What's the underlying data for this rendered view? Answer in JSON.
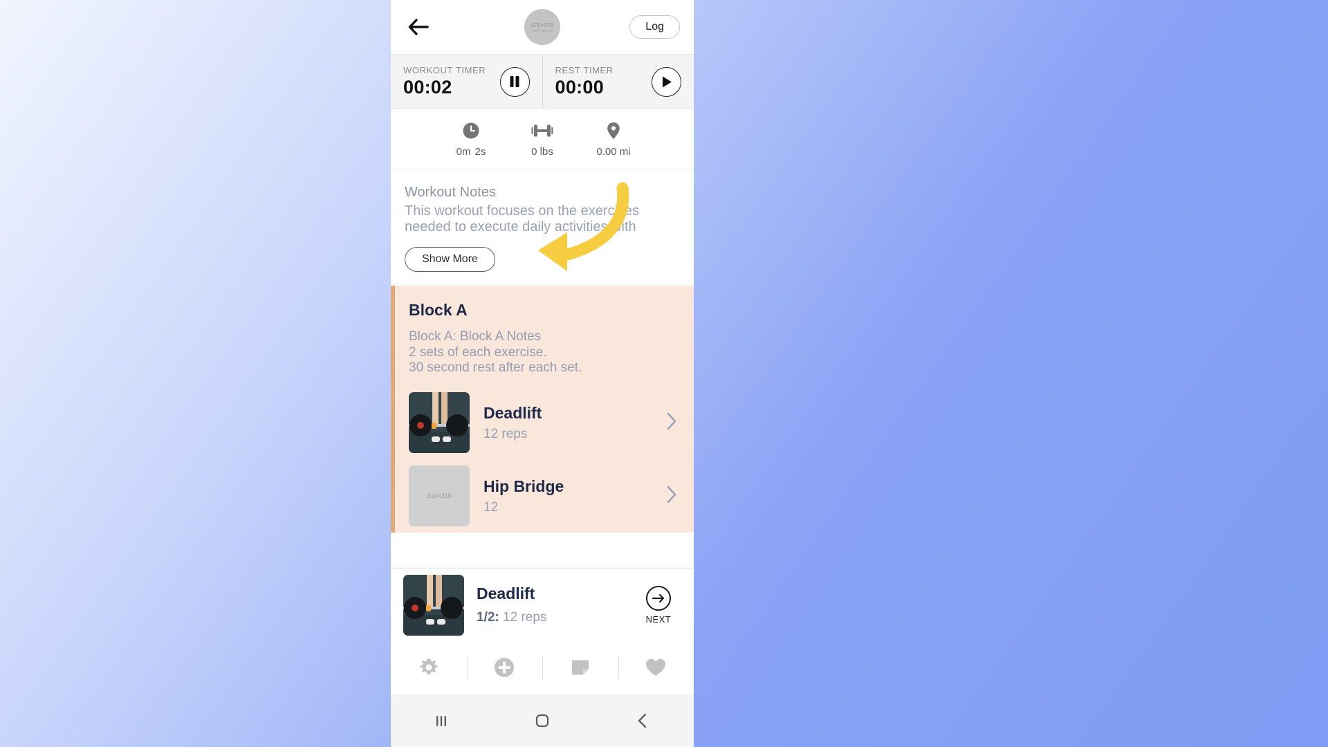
{
  "app": {
    "header": {
      "back_icon": "back-arrow-icon",
      "avatar_line1": "375×375",
      "avatar_line2": "neck_logo.png",
      "log_label": "Log"
    },
    "timers": [
      {
        "label": "WORKOUT TIMER",
        "value": "00:02",
        "control_icon": "pause-icon"
      },
      {
        "label": "REST TIMER",
        "value": "00:00",
        "control_icon": "play-icon"
      }
    ],
    "stats": [
      {
        "icon": "clock-icon",
        "value": "0m 2s",
        "v1": "0m",
        "v2": "2s"
      },
      {
        "icon": "dumbbell-icon",
        "value": "0 lbs"
      },
      {
        "icon": "location-pin-icon",
        "value": "0.00 mi"
      }
    ],
    "notes": {
      "title": "Workout Notes",
      "line1": "This workout focuses on the exercises",
      "line2": "needed to execute daily activities with",
      "show_more_label": "Show More"
    },
    "block": {
      "title": "Block A",
      "note_line1": "Block A: Block A Notes",
      "note_line2": "2 sets of each exercise.",
      "note_line3": "30 second rest after each set.",
      "exercises": [
        {
          "name": "Deadlift",
          "detail": "12 reps",
          "thumb": "deadlift-photo"
        },
        {
          "name": "Hip Bridge",
          "detail": "12",
          "thumb": "placeholder-image",
          "thumb_label": "310×310"
        }
      ]
    },
    "player": {
      "name": "Deadlift",
      "set_counter": "1/2:",
      "detail": "12 reps",
      "next_label": "NEXT",
      "next_icon": "arrow-right-circle-icon"
    },
    "toolbar": [
      {
        "icon": "gear-icon",
        "name": "settings"
      },
      {
        "icon": "plus-circle-icon",
        "name": "add"
      },
      {
        "icon": "note-icon",
        "name": "note"
      },
      {
        "icon": "heart-icon",
        "name": "favorite"
      }
    ],
    "navbar": [
      {
        "icon": "recents-icon",
        "name": "recents"
      },
      {
        "icon": "home-icon",
        "name": "home"
      },
      {
        "icon": "back-icon",
        "name": "back"
      }
    ],
    "annotation": {
      "type": "arrow",
      "color": "#f6cc40",
      "points_to": "show-more-button"
    }
  },
  "colors": {
    "block_bg": "#fae7dc",
    "block_accent": "#e0a97a",
    "text_dark": "#1e2a4a",
    "text_muted": "#97a0b3",
    "arrow": "#f6cc40"
  }
}
